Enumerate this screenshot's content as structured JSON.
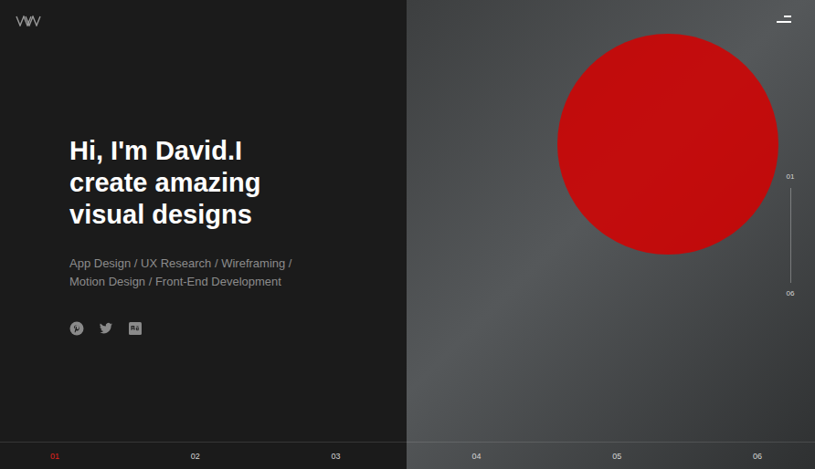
{
  "hero": {
    "heading_lines": [
      "Hi, I'm David.I",
      "create amazing",
      "visual designs"
    ],
    "skills_lines": [
      "App Design / UX Research / Wireframing /",
      "Motion Design / Front-End Development"
    ]
  },
  "side_indicator": {
    "first": "01",
    "last": "06"
  },
  "slides_nav": [
    {
      "label": "01",
      "selected": true
    },
    {
      "label": "02",
      "selected": false
    },
    {
      "label": "03",
      "selected": false
    },
    {
      "label": "04",
      "selected": false
    },
    {
      "label": "05",
      "selected": false
    },
    {
      "label": "06",
      "selected": false
    }
  ]
}
